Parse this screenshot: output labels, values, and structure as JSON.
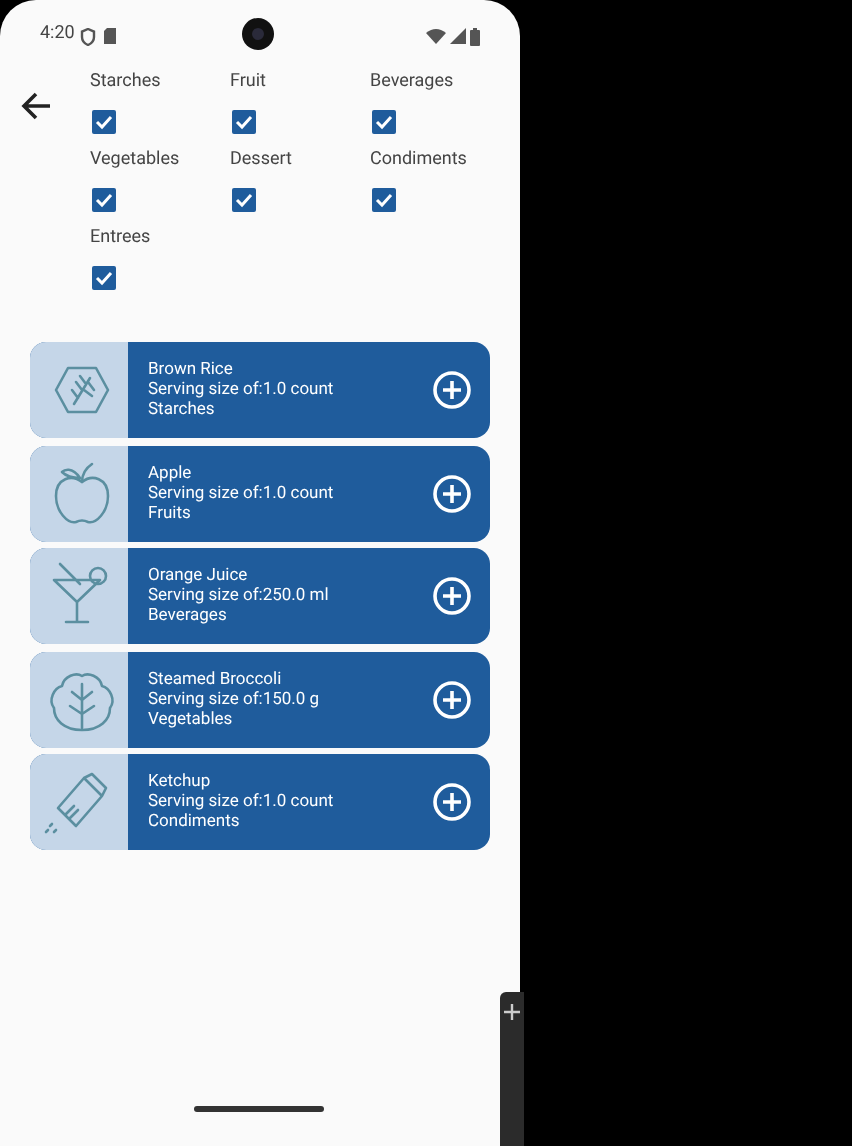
{
  "status_bar": {
    "time": "4:20"
  },
  "filters": [
    {
      "label": "Starches",
      "checked": true
    },
    {
      "label": "Fruit",
      "checked": true
    },
    {
      "label": "Beverages",
      "checked": true
    },
    {
      "label": "Vegetables",
      "checked": true
    },
    {
      "label": "Dessert",
      "checked": true
    },
    {
      "label": "Condiments",
      "checked": true
    },
    {
      "label": "Entrees",
      "checked": true
    }
  ],
  "foods": [
    {
      "kind": "grain",
      "name": "Brown Rice",
      "serving": "Serving size of:1.0 count",
      "category": "Starches"
    },
    {
      "kind": "apple",
      "name": "Apple",
      "serving": "Serving size of:1.0 count",
      "category": "Fruits"
    },
    {
      "kind": "cocktail",
      "name": "Orange Juice",
      "serving": "Serving size of:250.0 ml",
      "category": "Beverages"
    },
    {
      "kind": "lettuce",
      "name": "Steamed Broccoli",
      "serving": "Serving size of:150.0 g",
      "category": "Vegetables"
    },
    {
      "kind": "shaker",
      "name": "Ketchup",
      "serving": "Serving size of:1.0 count",
      "category": "Condiments"
    }
  ]
}
